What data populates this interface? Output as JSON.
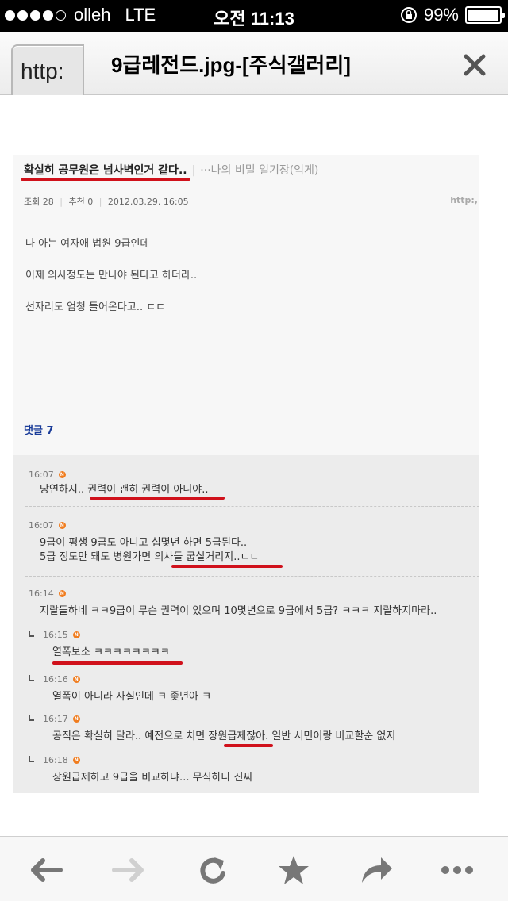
{
  "status_bar": {
    "carrier": "olleh",
    "network": "LTE",
    "time": "오전 11:13",
    "battery": "99%",
    "battery_level": 0.99,
    "signal_bars": 4
  },
  "title_bar": {
    "url_peek": "http:",
    "title": "9급레전드.jpg-[주식갤러리]"
  },
  "post": {
    "title": "확실히 공무원은 넘사벽인거 같다..",
    "blog_name": "···나의 비밀 일기장(익게)",
    "meta": {
      "views": "조회 28",
      "likes": "추천 0",
      "date": "2012.03.29. 16:05",
      "url_snippet": "http:,"
    },
    "body": [
      "나 아는 여자애 법원 9급인데",
      "이제 의사정도는 만나야 된다고 하더라..",
      "선자리도 엄청 들어온다고.. ㄷㄷ"
    ],
    "comment_link": "댓글 7"
  },
  "comments": [
    {
      "time": "16:07",
      "lines": [
        "당연하지.. 권력이 괜히 권력이 아니야.."
      ],
      "reply": false
    },
    {
      "time": "16:07",
      "lines": [
        "9급이 평생 9급도 아니고 십몇년 하면 5급된다..",
        "5급 정도만 돼도 병원가면 의사들 굽실거리지..ㄷㄷ"
      ],
      "reply": false
    },
    {
      "time": "16:14",
      "lines": [
        "지랄들하네 ㅋㅋ9급이 무슨 권력이 있으며 10몇년으로 9급에서 5급? ㅋㅋㅋ 지랄하지마라.."
      ],
      "reply": false
    },
    {
      "time": "16:15",
      "lines": [
        "열폭보소 ㅋㅋㅋㅋㅋㅋㅋㅋ"
      ],
      "reply": true
    },
    {
      "time": "16:16",
      "lines": [
        "열폭이 아니라 사실인데 ㅋ 좆년아 ㅋ"
      ],
      "reply": true
    },
    {
      "time": "16:17",
      "lines": [
        "공직은 확실히 달라.. 예전으로 치면 장원급제잖아. 일반 서민이랑 비교할순 없지"
      ],
      "reply": true
    },
    {
      "time": "16:18",
      "lines": [
        "장원급제하고 9급을 비교하냐... 무식하다 진짜"
      ],
      "reply": true
    }
  ],
  "badge_letter": "N",
  "colors": {
    "highlight_underline": "#d0111b",
    "badge": "#f07c1e",
    "link": "#1a3c99"
  },
  "toolbar": {
    "items": [
      "back-icon",
      "forward-icon",
      "refresh-icon",
      "bookmark-star-icon",
      "share-icon",
      "more-icon"
    ]
  }
}
